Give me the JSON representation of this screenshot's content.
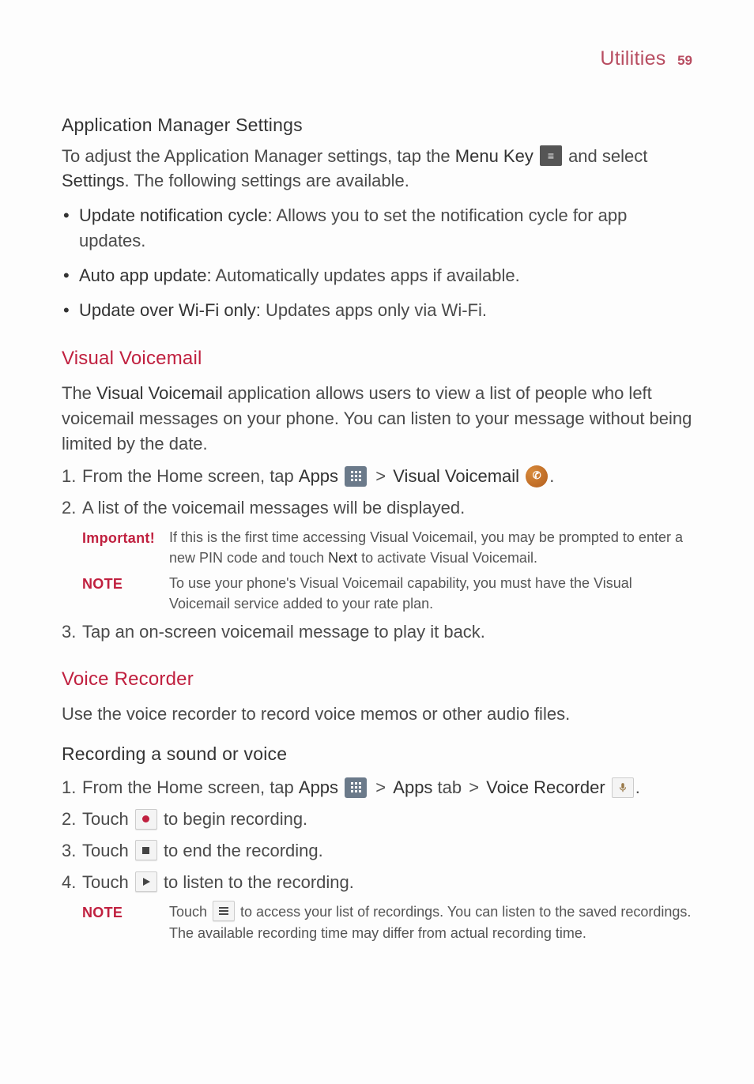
{
  "header": {
    "title": "Utilities",
    "page_number": "59"
  },
  "app_manager": {
    "heading": "Application Manager Settings",
    "intro_prefix": "To adjust the Application Manager settings, tap the ",
    "menu_key_label": "Menu Key",
    "intro_mid": " and select ",
    "settings_label": "Settings",
    "intro_suffix": ". The following settings are available.",
    "bullets": [
      {
        "label": "Update notification cycle:",
        "text": " Allows you to set the notification cycle for app updates."
      },
      {
        "label": "Auto app update:",
        "text": " Automatically updates apps if available."
      },
      {
        "label": "Update over Wi-Fi only:",
        "text": " Updates apps only via Wi-Fi."
      }
    ]
  },
  "visual_voicemail": {
    "title": "Visual Voicemail",
    "intro_prefix": "The ",
    "intro_bold": "Visual Voicemail",
    "intro_suffix": " application allows users to view a list of people who left voicemail messages on your phone. You can listen to your message without being limited by the date.",
    "step1_prefix": "From the Home screen, tap ",
    "apps_label": "Apps",
    "gt": ">",
    "vvm_label": "Visual Voicemail",
    "step1_suffix": ".",
    "step2": "A list of the voicemail messages will be displayed.",
    "important_label": "Important!",
    "important_prefix": "If this is the first time accessing Visual Voicemail, you may be prompted to enter a new PIN code and touch ",
    "important_bold": "Next",
    "important_suffix": " to activate Visual Voicemail.",
    "note_label": "NOTE",
    "note_text": "To use your phone's Visual Voicemail capability, you must have the Visual Voicemail service added to your rate plan.",
    "step3": "Tap an on-screen voicemail message to play it back."
  },
  "voice_recorder": {
    "title": "Voice Recorder",
    "intro": "Use the voice recorder to record voice memos or other audio files.",
    "sub_heading": "Recording a sound or voice",
    "step1_prefix": "From the Home screen, tap ",
    "apps_label": "Apps",
    "gt": ">",
    "apps_tab_label": "Apps",
    "tab_word": " tab ",
    "vr_label": "Voice Recorder",
    "step1_suffix": ".",
    "step2_prefix": "Touch ",
    "step2_suffix": " to begin recording.",
    "step3_prefix": "Touch ",
    "step3_suffix": " to end the recording.",
    "step4_prefix": "Touch ",
    "step4_suffix": " to listen to the recording.",
    "note_label": "NOTE",
    "note_prefix": "Touch ",
    "note_suffix": " to access your list of recordings. You can listen to the saved recordings. The available recording time may differ from actual recording time."
  }
}
